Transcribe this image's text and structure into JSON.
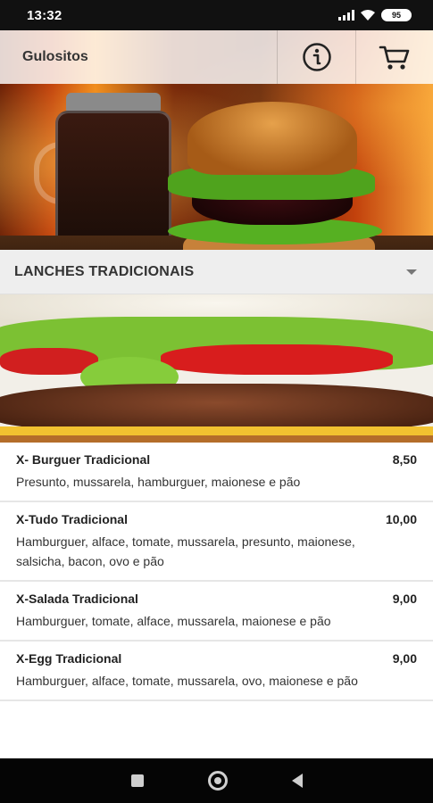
{
  "status_bar": {
    "time": "13:32",
    "battery": "95"
  },
  "header": {
    "app_name": "Gulositos",
    "info_icon": "info-icon",
    "cart_icon": "cart-icon"
  },
  "category": {
    "title": "LANCHES TRADICIONAIS",
    "arrow_icon": "chevron-down-icon"
  },
  "products": [
    {
      "name": "X- Burguer Tradicional",
      "price": "8,50",
      "description": "Presunto, mussarela, hamburguer, maionese e pão"
    },
    {
      "name": "X-Tudo Tradicional",
      "price": "10,00",
      "description": "Hamburguer, alface, tomate, mussarela, presunto, maionese, salsicha, bacon, ovo e pão"
    },
    {
      "name": "X-Salada Tradicional",
      "price": "9,00",
      "description": "Hamburguer, tomate, alface, mussarela, maionese e pão"
    },
    {
      "name": "X-Egg Tradicional",
      "price": "9,00",
      "description": "Hamburguer, alface, tomate, mussarela, ovo, maionese e pão"
    }
  ],
  "nav": {
    "recent": "square-icon",
    "home": "circle-icon",
    "back": "back-triangle-icon"
  }
}
